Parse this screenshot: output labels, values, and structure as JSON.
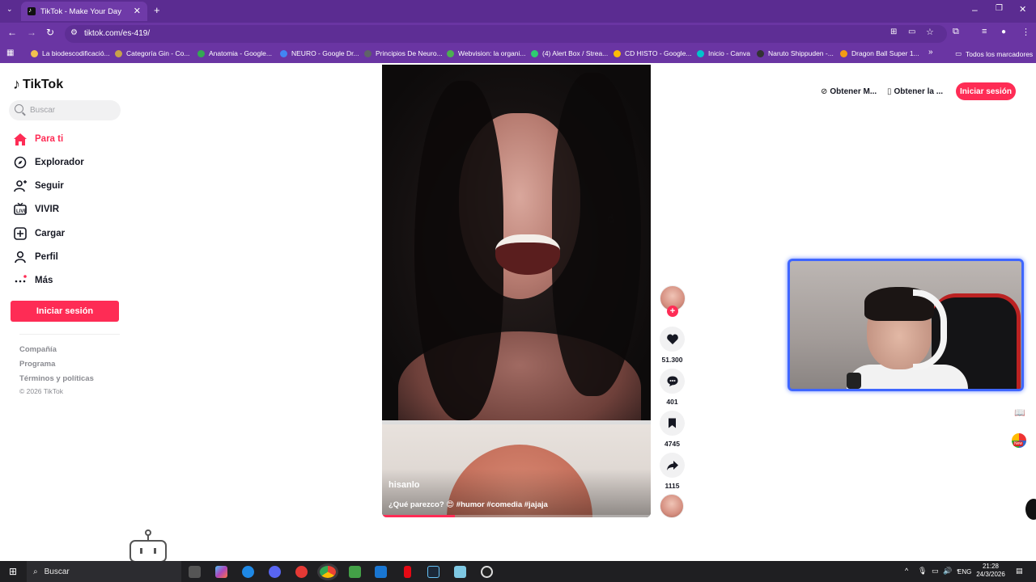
{
  "browser": {
    "tab_title": "TikTok - Make Your Day",
    "url": "tiktok.com/es-419/",
    "bookmarks": [
      {
        "label": "La biodescodificació...",
        "color": "#f2c14e"
      },
      {
        "label": "Categoría Gin - Co...",
        "color": "#c8a24a"
      },
      {
        "label": "Anatomia - Google...",
        "color": "#34a853"
      },
      {
        "label": "NEURO - Google Dr...",
        "color": "#4285f4"
      },
      {
        "label": "Principios De Neuro...",
        "color": "#5f6368"
      },
      {
        "label": "Webvision: la organi...",
        "color": "#4caf50"
      },
      {
        "label": "(4) Alert Box / Strea...",
        "color": "#2ecc71"
      },
      {
        "label": "CD HISTO - Google...",
        "color": "#fbbc05"
      },
      {
        "label": "Inicio - Canva",
        "color": "#00c4cc"
      },
      {
        "label": "Naruto Shippuden -...",
        "color": "#333333"
      },
      {
        "label": "Dragon Ball Super 1...",
        "color": "#f39c12"
      }
    ],
    "all_bookmarks": "Todos los marcadores"
  },
  "sidebar": {
    "logo": "TikTok",
    "search_placeholder": "Buscar",
    "nav": [
      {
        "label": "Para ti",
        "icon": "home-icon"
      },
      {
        "label": "Explorador",
        "icon": "compass-icon"
      },
      {
        "label": "Seguir",
        "icon": "follow-icon"
      },
      {
        "label": "VIVIR",
        "icon": "live-icon"
      },
      {
        "label": "Cargar",
        "icon": "upload-icon"
      },
      {
        "label": "Perfil",
        "icon": "profile-icon"
      },
      {
        "label": "Más",
        "icon": "more-icon"
      }
    ],
    "login": "Iniciar sesión",
    "footer": [
      "Compañía",
      "Programa",
      "Términos y políticas"
    ],
    "copyright": "© 2026 TikTok"
  },
  "header": {
    "get_coins": "Obtener M...",
    "get_app": "Obtener la ...",
    "login": "Iniciar sesión"
  },
  "video": {
    "author": "hisanlo",
    "caption": "¿Qué parezco? 😍 #humor #comedia #jajaja",
    "progress": 0.27
  },
  "actions": {
    "likes": "51.300",
    "comments": "401",
    "saves": "4745",
    "shares": "1115"
  },
  "taskbar": {
    "search": "Buscar",
    "lang": "ENG",
    "time": "21:28",
    "date": "24/3/2026"
  },
  "colors": {
    "accent": "#fe2c55",
    "browser_frame": "#5b2c91",
    "webcam_border": "#3f66ff"
  }
}
